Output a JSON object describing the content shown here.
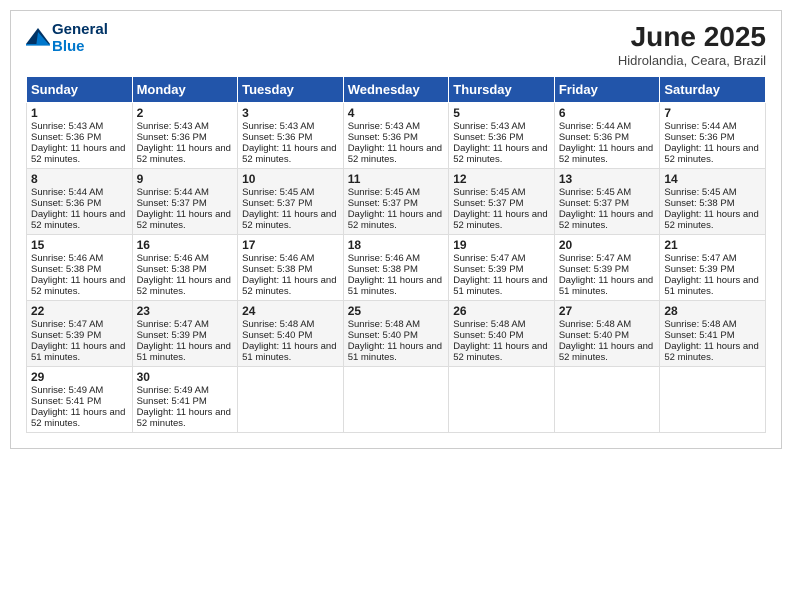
{
  "header": {
    "logo_line1": "General",
    "logo_line2": "Blue",
    "month_title": "June 2025",
    "location": "Hidrolandia, Ceara, Brazil"
  },
  "days_of_week": [
    "Sunday",
    "Monday",
    "Tuesday",
    "Wednesday",
    "Thursday",
    "Friday",
    "Saturday"
  ],
  "weeks": [
    [
      {
        "day": 1,
        "sunrise": "5:43 AM",
        "sunset": "5:36 PM",
        "daylight": "11 hours and 52 minutes."
      },
      {
        "day": 2,
        "sunrise": "5:43 AM",
        "sunset": "5:36 PM",
        "daylight": "11 hours and 52 minutes."
      },
      {
        "day": 3,
        "sunrise": "5:43 AM",
        "sunset": "5:36 PM",
        "daylight": "11 hours and 52 minutes."
      },
      {
        "day": 4,
        "sunrise": "5:43 AM",
        "sunset": "5:36 PM",
        "daylight": "11 hours and 52 minutes."
      },
      {
        "day": 5,
        "sunrise": "5:43 AM",
        "sunset": "5:36 PM",
        "daylight": "11 hours and 52 minutes."
      },
      {
        "day": 6,
        "sunrise": "5:44 AM",
        "sunset": "5:36 PM",
        "daylight": "11 hours and 52 minutes."
      },
      {
        "day": 7,
        "sunrise": "5:44 AM",
        "sunset": "5:36 PM",
        "daylight": "11 hours and 52 minutes."
      }
    ],
    [
      {
        "day": 8,
        "sunrise": "5:44 AM",
        "sunset": "5:36 PM",
        "daylight": "11 hours and 52 minutes."
      },
      {
        "day": 9,
        "sunrise": "5:44 AM",
        "sunset": "5:37 PM",
        "daylight": "11 hours and 52 minutes."
      },
      {
        "day": 10,
        "sunrise": "5:45 AM",
        "sunset": "5:37 PM",
        "daylight": "11 hours and 52 minutes."
      },
      {
        "day": 11,
        "sunrise": "5:45 AM",
        "sunset": "5:37 PM",
        "daylight": "11 hours and 52 minutes."
      },
      {
        "day": 12,
        "sunrise": "5:45 AM",
        "sunset": "5:37 PM",
        "daylight": "11 hours and 52 minutes."
      },
      {
        "day": 13,
        "sunrise": "5:45 AM",
        "sunset": "5:37 PM",
        "daylight": "11 hours and 52 minutes."
      },
      {
        "day": 14,
        "sunrise": "5:45 AM",
        "sunset": "5:38 PM",
        "daylight": "11 hours and 52 minutes."
      }
    ],
    [
      {
        "day": 15,
        "sunrise": "5:46 AM",
        "sunset": "5:38 PM",
        "daylight": "11 hours and 52 minutes."
      },
      {
        "day": 16,
        "sunrise": "5:46 AM",
        "sunset": "5:38 PM",
        "daylight": "11 hours and 52 minutes."
      },
      {
        "day": 17,
        "sunrise": "5:46 AM",
        "sunset": "5:38 PM",
        "daylight": "11 hours and 52 minutes."
      },
      {
        "day": 18,
        "sunrise": "5:46 AM",
        "sunset": "5:38 PM",
        "daylight": "11 hours and 51 minutes."
      },
      {
        "day": 19,
        "sunrise": "5:47 AM",
        "sunset": "5:39 PM",
        "daylight": "11 hours and 51 minutes."
      },
      {
        "day": 20,
        "sunrise": "5:47 AM",
        "sunset": "5:39 PM",
        "daylight": "11 hours and 51 minutes."
      },
      {
        "day": 21,
        "sunrise": "5:47 AM",
        "sunset": "5:39 PM",
        "daylight": "11 hours and 51 minutes."
      }
    ],
    [
      {
        "day": 22,
        "sunrise": "5:47 AM",
        "sunset": "5:39 PM",
        "daylight": "11 hours and 51 minutes."
      },
      {
        "day": 23,
        "sunrise": "5:47 AM",
        "sunset": "5:39 PM",
        "daylight": "11 hours and 51 minutes."
      },
      {
        "day": 24,
        "sunrise": "5:48 AM",
        "sunset": "5:40 PM",
        "daylight": "11 hours and 51 minutes."
      },
      {
        "day": 25,
        "sunrise": "5:48 AM",
        "sunset": "5:40 PM",
        "daylight": "11 hours and 51 minutes."
      },
      {
        "day": 26,
        "sunrise": "5:48 AM",
        "sunset": "5:40 PM",
        "daylight": "11 hours and 52 minutes."
      },
      {
        "day": 27,
        "sunrise": "5:48 AM",
        "sunset": "5:40 PM",
        "daylight": "11 hours and 52 minutes."
      },
      {
        "day": 28,
        "sunrise": "5:48 AM",
        "sunset": "5:41 PM",
        "daylight": "11 hours and 52 minutes."
      }
    ],
    [
      {
        "day": 29,
        "sunrise": "5:49 AM",
        "sunset": "5:41 PM",
        "daylight": "11 hours and 52 minutes."
      },
      {
        "day": 30,
        "sunrise": "5:49 AM",
        "sunset": "5:41 PM",
        "daylight": "11 hours and 52 minutes."
      },
      null,
      null,
      null,
      null,
      null
    ]
  ]
}
